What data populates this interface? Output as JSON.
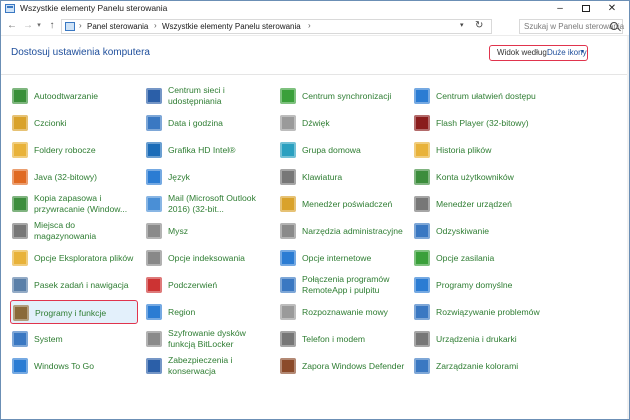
{
  "window": {
    "title": "Wszystkie elementy Panelu sterowania",
    "controls": {
      "minimize": "–",
      "close": "✕"
    }
  },
  "nav": {
    "back": "←",
    "forward": "→",
    "recent": "▾",
    "up": "↑"
  },
  "address": {
    "crumbs": [
      "Panel sterowania",
      "Wszystkie elementy Panelu sterowania"
    ],
    "separator": "›",
    "dropdown": "▾",
    "refresh": "↻"
  },
  "search": {
    "placeholder": "Szukaj w Panelu sterowania"
  },
  "header": {
    "title": "Dostosuj ustawienia komputera",
    "view_by_label": "Widok według:",
    "view_by_value": "Duże ikony",
    "view_by_caret": "▾"
  },
  "items": {
    "col1": [
      {
        "label": "Autoodtwarzanie",
        "icon": "autoplay-icon",
        "color": "#3a8f3a"
      },
      {
        "label": "Czcionki",
        "icon": "fonts-icon",
        "color": "#d9a22b"
      },
      {
        "label": "Foldery robocze",
        "icon": "work-folders-icon",
        "color": "#e8b23a"
      },
      {
        "label": "Java (32-bitowy)",
        "icon": "java-icon",
        "color": "#e06a22"
      },
      {
        "label": "Kopia zapasowa i przywracanie (Window...",
        "icon": "backup-restore-icon",
        "color": "#3c8d3c"
      },
      {
        "label": "Miejsca do magazynowania",
        "icon": "storage-spaces-icon",
        "color": "#777777"
      },
      {
        "label": "Opcje Eksploratora plików",
        "icon": "file-explorer-options-icon",
        "color": "#e8b23a"
      },
      {
        "label": "Pasek zadań i nawigacja",
        "icon": "taskbar-navigation-icon",
        "color": "#5a7fa8"
      },
      {
        "label": "Programy i funkcje",
        "icon": "programs-features-icon",
        "color": "#8a6a3a"
      },
      {
        "label": "System",
        "icon": "system-icon",
        "color": "#3a78c2"
      },
      {
        "label": "Windows To Go",
        "icon": "windows-to-go-icon",
        "color": "#2b7cd3"
      }
    ],
    "col2": [
      {
        "label": "Centrum sieci i udostępniania",
        "icon": "network-sharing-icon",
        "color": "#2b5fa8"
      },
      {
        "label": "Data i godzina",
        "icon": "date-time-icon",
        "color": "#3a78c2"
      },
      {
        "label": "Grafika HD Intel®",
        "icon": "intel-graphics-icon",
        "color": "#1b6cb8"
      },
      {
        "label": "Język",
        "icon": "language-icon",
        "color": "#2b7cd3"
      },
      {
        "label": "Mail (Microsoft Outlook 2016) (32-bit...",
        "icon": "mail-icon",
        "color": "#4a8fd6"
      },
      {
        "label": "Mysz",
        "icon": "mouse-icon",
        "color": "#8a8a8a"
      },
      {
        "label": "Opcje indeksowania",
        "icon": "indexing-options-icon",
        "color": "#888888"
      },
      {
        "label": "Podczerwień",
        "icon": "infrared-icon",
        "color": "#cc3333"
      },
      {
        "label": "Region",
        "icon": "region-icon",
        "color": "#2b7cd3"
      },
      {
        "label": "Szyfrowanie dysków funkcją BitLocker",
        "icon": "bitlocker-icon",
        "color": "#8a8a8a"
      },
      {
        "label": "Zabezpieczenia i konserwacja",
        "icon": "security-maintenance-icon",
        "color": "#2b5fa8"
      }
    ],
    "col3": [
      {
        "label": "Centrum synchronizacji",
        "icon": "sync-center-icon",
        "color": "#3aa03a"
      },
      {
        "label": "Dźwięk",
        "icon": "sound-icon",
        "color": "#9a9a9a"
      },
      {
        "label": "Grupa domowa",
        "icon": "homegroup-icon",
        "color": "#2aa0c0"
      },
      {
        "label": "Klawiatura",
        "icon": "keyboard-icon",
        "color": "#777777"
      },
      {
        "label": "Menedżer poświadczeń",
        "icon": "credential-manager-icon",
        "color": "#d9a22b"
      },
      {
        "label": "Narzędzia administracyjne",
        "icon": "admin-tools-icon",
        "color": "#8a8a8a"
      },
      {
        "label": "Opcje internetowe",
        "icon": "internet-options-icon",
        "color": "#2b7cd3"
      },
      {
        "label": "Połączenia programów RemoteApp i pulpitu",
        "icon": "remoteapp-icon",
        "color": "#3a78c2"
      },
      {
        "label": "Rozpoznawanie mowy",
        "icon": "speech-recognition-icon",
        "color": "#9a9a9a"
      },
      {
        "label": "Telefon i modem",
        "icon": "phone-modem-icon",
        "color": "#777777"
      },
      {
        "label": "Zapora Windows Defender",
        "icon": "firewall-icon",
        "color": "#8b4a2a"
      }
    ],
    "col4": [
      {
        "label": "Centrum ułatwień dostępu",
        "icon": "ease-of-access-icon",
        "color": "#2b7cd3"
      },
      {
        "label": "Flash Player (32-bitowy)",
        "icon": "flash-player-icon",
        "color": "#8a1c1c"
      },
      {
        "label": "Historia plików",
        "icon": "file-history-icon",
        "color": "#e8b23a"
      },
      {
        "label": "Konta użytkowników",
        "icon": "user-accounts-icon",
        "color": "#3c8d3c"
      },
      {
        "label": "Menedżer urządzeń",
        "icon": "device-manager-icon",
        "color": "#777777"
      },
      {
        "label": "Odzyskiwanie",
        "icon": "recovery-icon",
        "color": "#3a78c2"
      },
      {
        "label": "Opcje zasilania",
        "icon": "power-options-icon",
        "color": "#3aa03a"
      },
      {
        "label": "Programy domyślne",
        "icon": "default-programs-icon",
        "color": "#2b7cd3"
      },
      {
        "label": "Rozwiązywanie problemów",
        "icon": "troubleshooting-icon",
        "color": "#3a78c2"
      },
      {
        "label": "Urządzenia i drukarki",
        "icon": "devices-printers-icon",
        "color": "#777777"
      },
      {
        "label": "Zarządzanie kolorami",
        "icon": "color-management-icon",
        "color": "#3a78c2"
      }
    ]
  },
  "colors": {
    "link_green": "#2e7d32",
    "header_blue": "#1e4e9b",
    "highlight_border": "#e0344d",
    "highlight_fill": "#e3f0fb"
  }
}
